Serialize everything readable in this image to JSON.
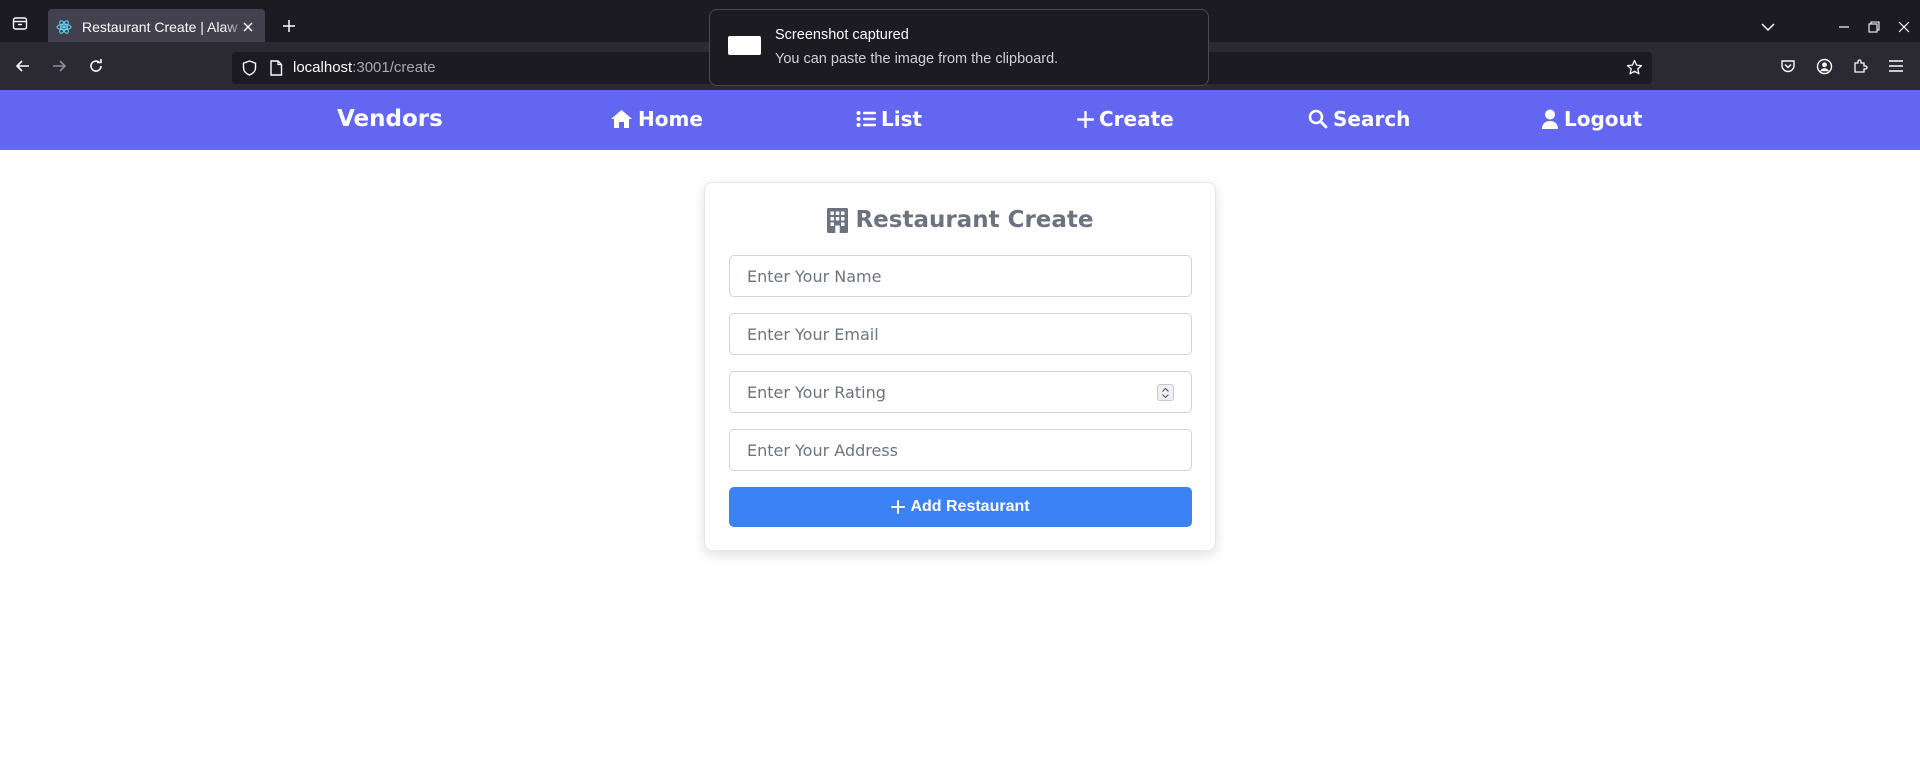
{
  "browser": {
    "tab_title": "Restaurant Create | Alaw",
    "url_host": "localhost",
    "url_rest": ":3001/create"
  },
  "toast": {
    "title": "Screenshot captured",
    "body": "You can paste the image from the clipboard."
  },
  "app": {
    "brand": "Vendors",
    "nav": [
      {
        "label": "Home",
        "icon": "home-icon"
      },
      {
        "label": "List",
        "icon": "list-icon"
      },
      {
        "label": "Create",
        "icon": "plus-icon"
      },
      {
        "label": "Search",
        "icon": "search-icon"
      },
      {
        "label": "Logout",
        "icon": "user-icon"
      }
    ],
    "accent": "#6366f1"
  },
  "form": {
    "title": "Restaurant Create",
    "name_placeholder": "Enter Your Name",
    "email_placeholder": "Enter Your Email",
    "rating_placeholder": "Enter Your Rating",
    "address_placeholder": "Enter Your Address",
    "submit_label": "Add Restaurant",
    "button_color": "#3b82f6"
  }
}
